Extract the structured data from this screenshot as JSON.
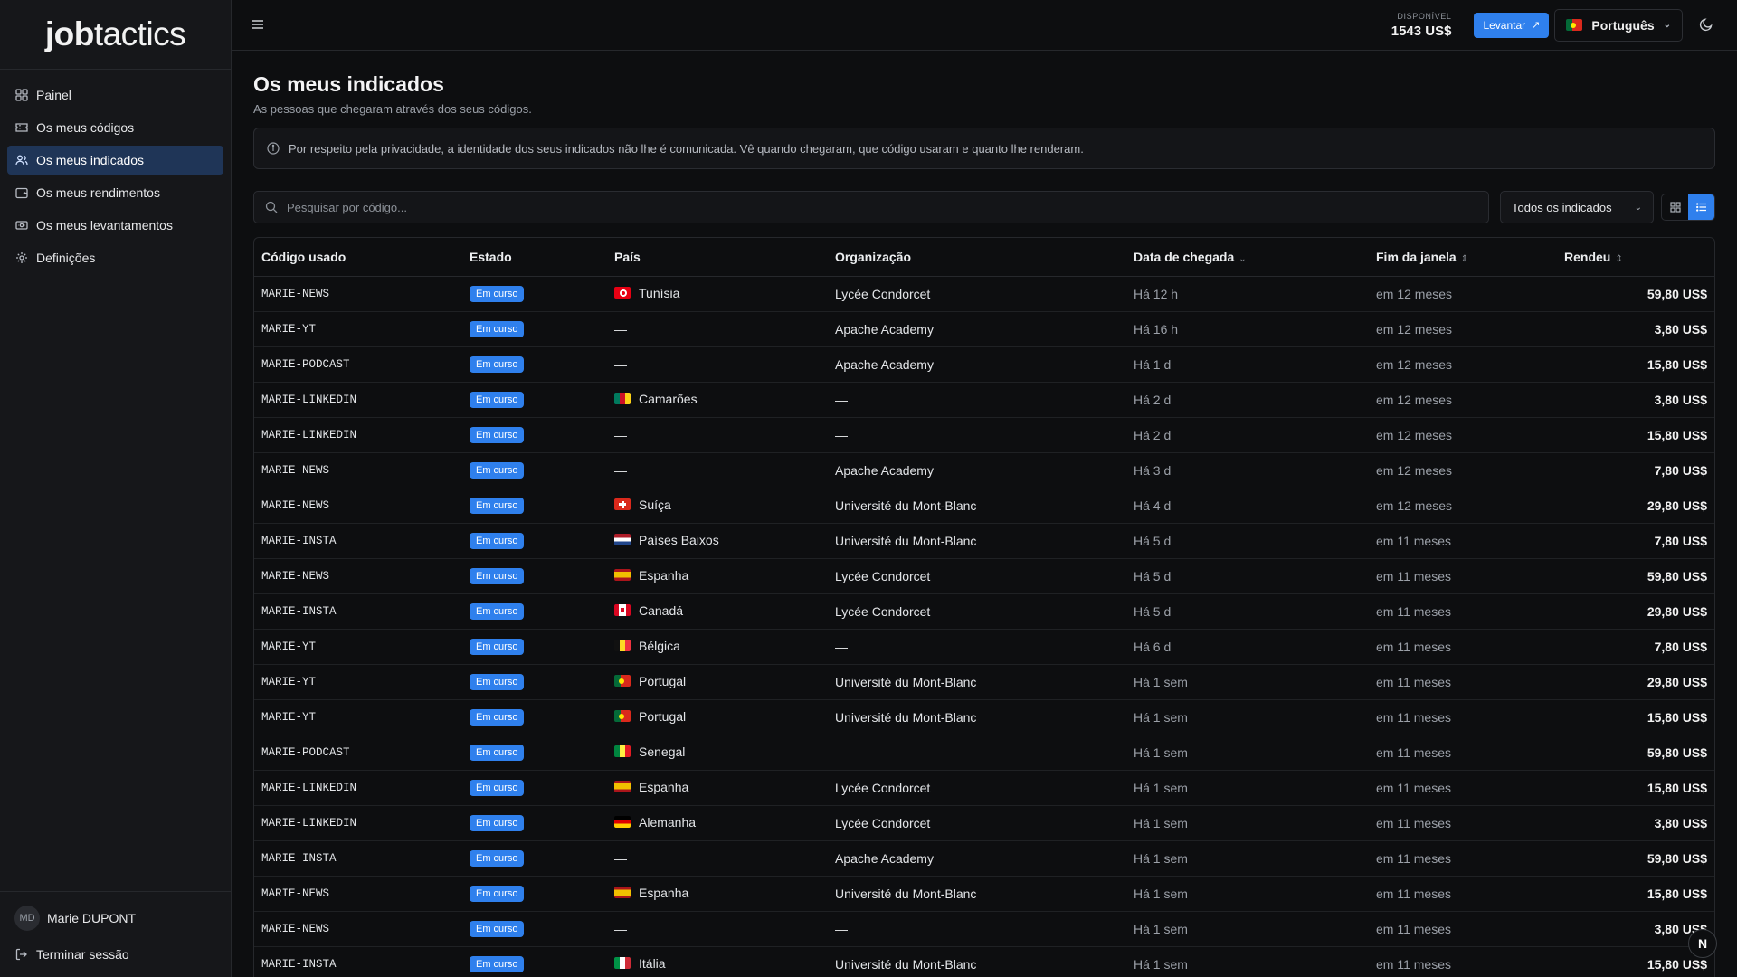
{
  "brand": {
    "part1": "job",
    "part2": "tactics"
  },
  "sidebar": {
    "items": [
      {
        "label": "Painel",
        "icon": "dashboard-icon"
      },
      {
        "label": "Os meus códigos",
        "icon": "ticket-icon"
      },
      {
        "label": "Os meus indicados",
        "icon": "users-icon",
        "active": true
      },
      {
        "label": "Os meus rendimentos",
        "icon": "wallet-icon"
      },
      {
        "label": "Os meus levantamentos",
        "icon": "banknote-icon"
      },
      {
        "label": "Definições",
        "icon": "gear-icon"
      }
    ],
    "user": {
      "initials": "MD",
      "name": "Marie DUPONT"
    },
    "logout": "Terminar sessão"
  },
  "topbar": {
    "balance_label": "DISPONÍVEL",
    "balance_value": "1543 US$",
    "withdraw_label": "Levantar",
    "language": "Português"
  },
  "page": {
    "title": "Os meus indicados",
    "subtitle": "As pessoas que chegaram através dos seus códigos.",
    "notice": "Por respeito pela privacidade, a identidade dos seus indicados não lhe é comunicada. Vê quando chegaram, que código usaram e quanto lhe renderam."
  },
  "search": {
    "placeholder": "Pesquisar por código..."
  },
  "filter": {
    "selected": "Todos os indicados"
  },
  "table": {
    "headers": [
      "Código usado",
      "Estado",
      "País",
      "Organização",
      "Data de chegada",
      "Fim da janela",
      "Rendeu"
    ],
    "rows": [
      {
        "code": "MARIE-NEWS",
        "status": "Em curso",
        "country": "Tunísia",
        "flag": "tn",
        "org": "Lycée Condorcet",
        "arrived": "Há 12 h",
        "end": "em 12 meses",
        "amount": "59,80 US$"
      },
      {
        "code": "MARIE-YT",
        "status": "Em curso",
        "country": "—",
        "flag": "",
        "org": "Apache Academy",
        "arrived": "Há 16 h",
        "end": "em 12 meses",
        "amount": "3,80 US$"
      },
      {
        "code": "MARIE-PODCAST",
        "status": "Em curso",
        "country": "—",
        "flag": "",
        "org": "Apache Academy",
        "arrived": "Há 1 d",
        "end": "em 12 meses",
        "amount": "15,80 US$"
      },
      {
        "code": "MARIE-LINKEDIN",
        "status": "Em curso",
        "country": "Camarões",
        "flag": "cm",
        "org": "—",
        "arrived": "Há 2 d",
        "end": "em 12 meses",
        "amount": "3,80 US$"
      },
      {
        "code": "MARIE-LINKEDIN",
        "status": "Em curso",
        "country": "—",
        "flag": "",
        "org": "—",
        "arrived": "Há 2 d",
        "end": "em 12 meses",
        "amount": "15,80 US$"
      },
      {
        "code": "MARIE-NEWS",
        "status": "Em curso",
        "country": "—",
        "flag": "",
        "org": "Apache Academy",
        "arrived": "Há 3 d",
        "end": "em 12 meses",
        "amount": "7,80 US$"
      },
      {
        "code": "MARIE-NEWS",
        "status": "Em curso",
        "country": "Suíça",
        "flag": "ch",
        "org": "Université du Mont-Blanc",
        "arrived": "Há 4 d",
        "end": "em 12 meses",
        "amount": "29,80 US$"
      },
      {
        "code": "MARIE-INSTA",
        "status": "Em curso",
        "country": "Países Baixos",
        "flag": "nl",
        "org": "Université du Mont-Blanc",
        "arrived": "Há 5 d",
        "end": "em 11 meses",
        "amount": "7,80 US$"
      },
      {
        "code": "MARIE-NEWS",
        "status": "Em curso",
        "country": "Espanha",
        "flag": "es",
        "org": "Lycée Condorcet",
        "arrived": "Há 5 d",
        "end": "em 11 meses",
        "amount": "59,80 US$"
      },
      {
        "code": "MARIE-INSTA",
        "status": "Em curso",
        "country": "Canadá",
        "flag": "ca",
        "org": "Lycée Condorcet",
        "arrived": "Há 5 d",
        "end": "em 11 meses",
        "amount": "29,80 US$"
      },
      {
        "code": "MARIE-YT",
        "status": "Em curso",
        "country": "Bélgica",
        "flag": "be",
        "org": "—",
        "arrived": "Há 6 d",
        "end": "em 11 meses",
        "amount": "7,80 US$"
      },
      {
        "code": "MARIE-YT",
        "status": "Em curso",
        "country": "Portugal",
        "flag": "pt",
        "org": "Université du Mont-Blanc",
        "arrived": "Há 1 sem",
        "end": "em 11 meses",
        "amount": "29,80 US$"
      },
      {
        "code": "MARIE-YT",
        "status": "Em curso",
        "country": "Portugal",
        "flag": "pt",
        "org": "Université du Mont-Blanc",
        "arrived": "Há 1 sem",
        "end": "em 11 meses",
        "amount": "15,80 US$"
      },
      {
        "code": "MARIE-PODCAST",
        "status": "Em curso",
        "country": "Senegal",
        "flag": "sn",
        "org": "—",
        "arrived": "Há 1 sem",
        "end": "em 11 meses",
        "amount": "59,80 US$"
      },
      {
        "code": "MARIE-LINKEDIN",
        "status": "Em curso",
        "country": "Espanha",
        "flag": "es",
        "org": "Lycée Condorcet",
        "arrived": "Há 1 sem",
        "end": "em 11 meses",
        "amount": "15,80 US$"
      },
      {
        "code": "MARIE-LINKEDIN",
        "status": "Em curso",
        "country": "Alemanha",
        "flag": "de",
        "org": "Lycée Condorcet",
        "arrived": "Há 1 sem",
        "end": "em 11 meses",
        "amount": "3,80 US$"
      },
      {
        "code": "MARIE-INSTA",
        "status": "Em curso",
        "country": "—",
        "flag": "",
        "org": "Apache Academy",
        "arrived": "Há 1 sem",
        "end": "em 11 meses",
        "amount": "59,80 US$"
      },
      {
        "code": "MARIE-NEWS",
        "status": "Em curso",
        "country": "Espanha",
        "flag": "es",
        "org": "Université du Mont-Blanc",
        "arrived": "Há 1 sem",
        "end": "em 11 meses",
        "amount": "15,80 US$"
      },
      {
        "code": "MARIE-NEWS",
        "status": "Em curso",
        "country": "—",
        "flag": "",
        "org": "—",
        "arrived": "Há 1 sem",
        "end": "em 11 meses",
        "amount": "3,80 US$"
      },
      {
        "code": "MARIE-INSTA",
        "status": "Em curso",
        "country": "Itália",
        "flag": "it",
        "org": "Université du Mont-Blanc",
        "arrived": "Há 1 sem",
        "end": "em 11 meses",
        "amount": "15,80 US$"
      }
    ]
  },
  "corner_button": "N",
  "colors": {
    "accent": "#2f80ed",
    "background": "#0d0e10",
    "sidebar": "#16171a"
  }
}
